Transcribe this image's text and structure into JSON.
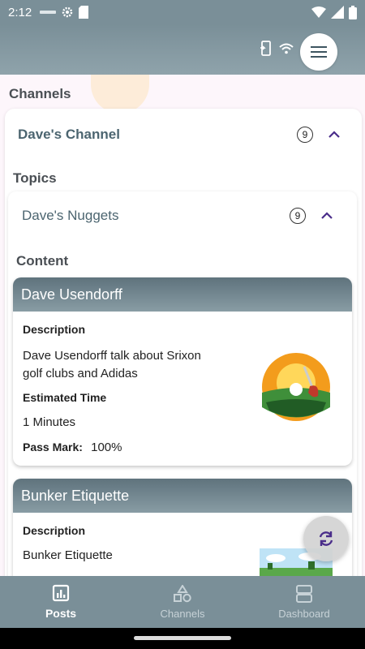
{
  "status_bar": {
    "time": "2:12"
  },
  "sections": {
    "channels_label": "Channels",
    "topics_label": "Topics",
    "content_label": "Content"
  },
  "channel": {
    "name": "Dave's Channel",
    "count": "9"
  },
  "topic": {
    "name": "Dave's Nuggets",
    "count": "9"
  },
  "posts": [
    {
      "title": "Dave Usendorff",
      "description_label": "Description",
      "description": "Dave Usendorff talk about Srixon golf clubs and Adidas",
      "time_label": "Estimated Time",
      "time_value": "1 Minutes",
      "pass_label": "Pass Mark:",
      "pass_value": "100%"
    },
    {
      "title": "Bunker Etiquette",
      "description_label": "Description",
      "description": "Bunker Etiquette"
    }
  ],
  "bottom_nav": [
    {
      "label": "Posts",
      "icon": "chart-icon",
      "active": true
    },
    {
      "label": "Channels",
      "icon": "shapes-icon",
      "active": false
    },
    {
      "label": "Dashboard",
      "icon": "dashboard-icon",
      "active": false
    }
  ],
  "colors": {
    "header": "#7a8f98",
    "accent_purple": "#4a2d8a",
    "card_header": "#6f838c"
  }
}
